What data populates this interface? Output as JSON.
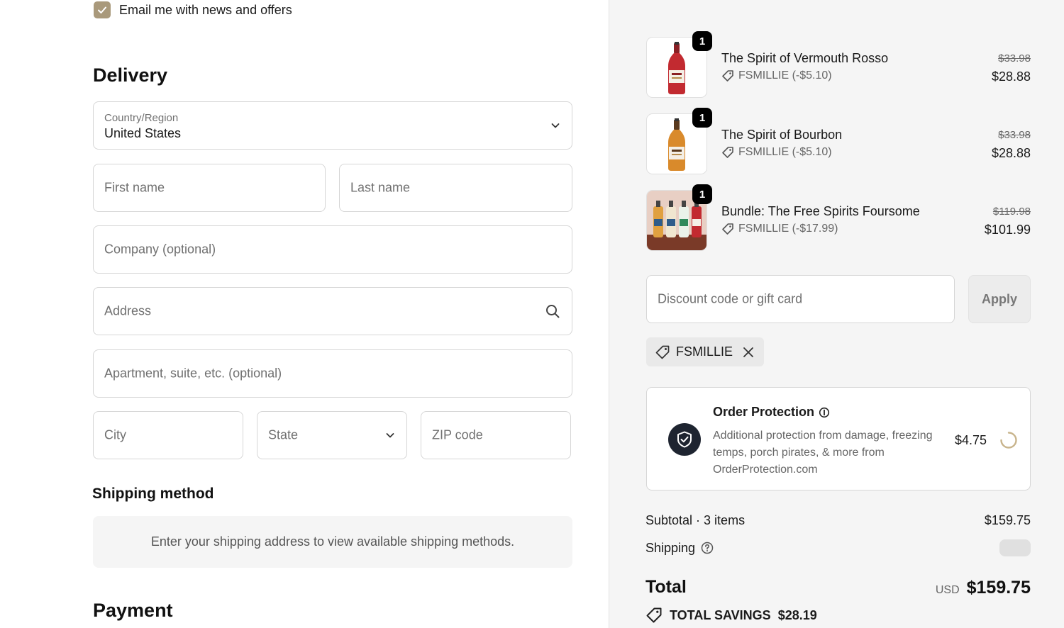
{
  "contact": {
    "news_checkbox_checked": true,
    "news_label": "Email me with news and offers"
  },
  "delivery": {
    "heading": "Delivery",
    "country_label": "Country/Region",
    "country_value": "United States",
    "first_name_placeholder": "First name",
    "last_name_placeholder": "Last name",
    "company_placeholder": "Company (optional)",
    "address_placeholder": "Address",
    "apartment_placeholder": "Apartment, suite, etc. (optional)",
    "city_placeholder": "City",
    "state_placeholder": "State",
    "zip_placeholder": "ZIP code"
  },
  "shipping_method": {
    "heading": "Shipping method",
    "notice": "Enter your shipping address to view available shipping methods."
  },
  "payment": {
    "heading": "Payment"
  },
  "cart": {
    "items": [
      {
        "quantity": "1",
        "name": "The Spirit of Vermouth Rosso",
        "discount": "FSMILLIE (-$5.10)",
        "original_price": "$33.98",
        "price": "$28.88",
        "thumb_icon": "red-bottle-icon"
      },
      {
        "quantity": "1",
        "name": "The Spirit of Bourbon",
        "discount": "FSMILLIE (-$5.10)",
        "original_price": "$33.98",
        "price": "$28.88",
        "thumb_icon": "amber-bottle-icon"
      },
      {
        "quantity": "1",
        "name": "Bundle: The Free Spirits Foursome",
        "discount": "FSMILLIE (-$17.99)",
        "original_price": "$119.98",
        "price": "$101.99",
        "thumb_icon": "four-bottles-icon"
      }
    ]
  },
  "discount": {
    "placeholder": "Discount code or gift card",
    "apply_label": "Apply",
    "applied_code": "FSMILLIE"
  },
  "order_protection": {
    "title": "Order Protection",
    "description": "Additional protection from damage, freezing temps, porch pirates, & more from OrderProtection.com",
    "price": "$4.75"
  },
  "summary": {
    "subtotal_label": "Subtotal · 3 items",
    "subtotal_value": "$159.75",
    "shipping_label": "Shipping",
    "total_label": "Total",
    "currency": "USD",
    "total_value": "$159.75",
    "savings_label": "TOTAL SAVINGS",
    "savings_value": "$28.19"
  },
  "colors": {
    "checkbox": "#a9997b",
    "shield_badge": "#1e2430",
    "summary_bg": "#f5f5f5"
  }
}
